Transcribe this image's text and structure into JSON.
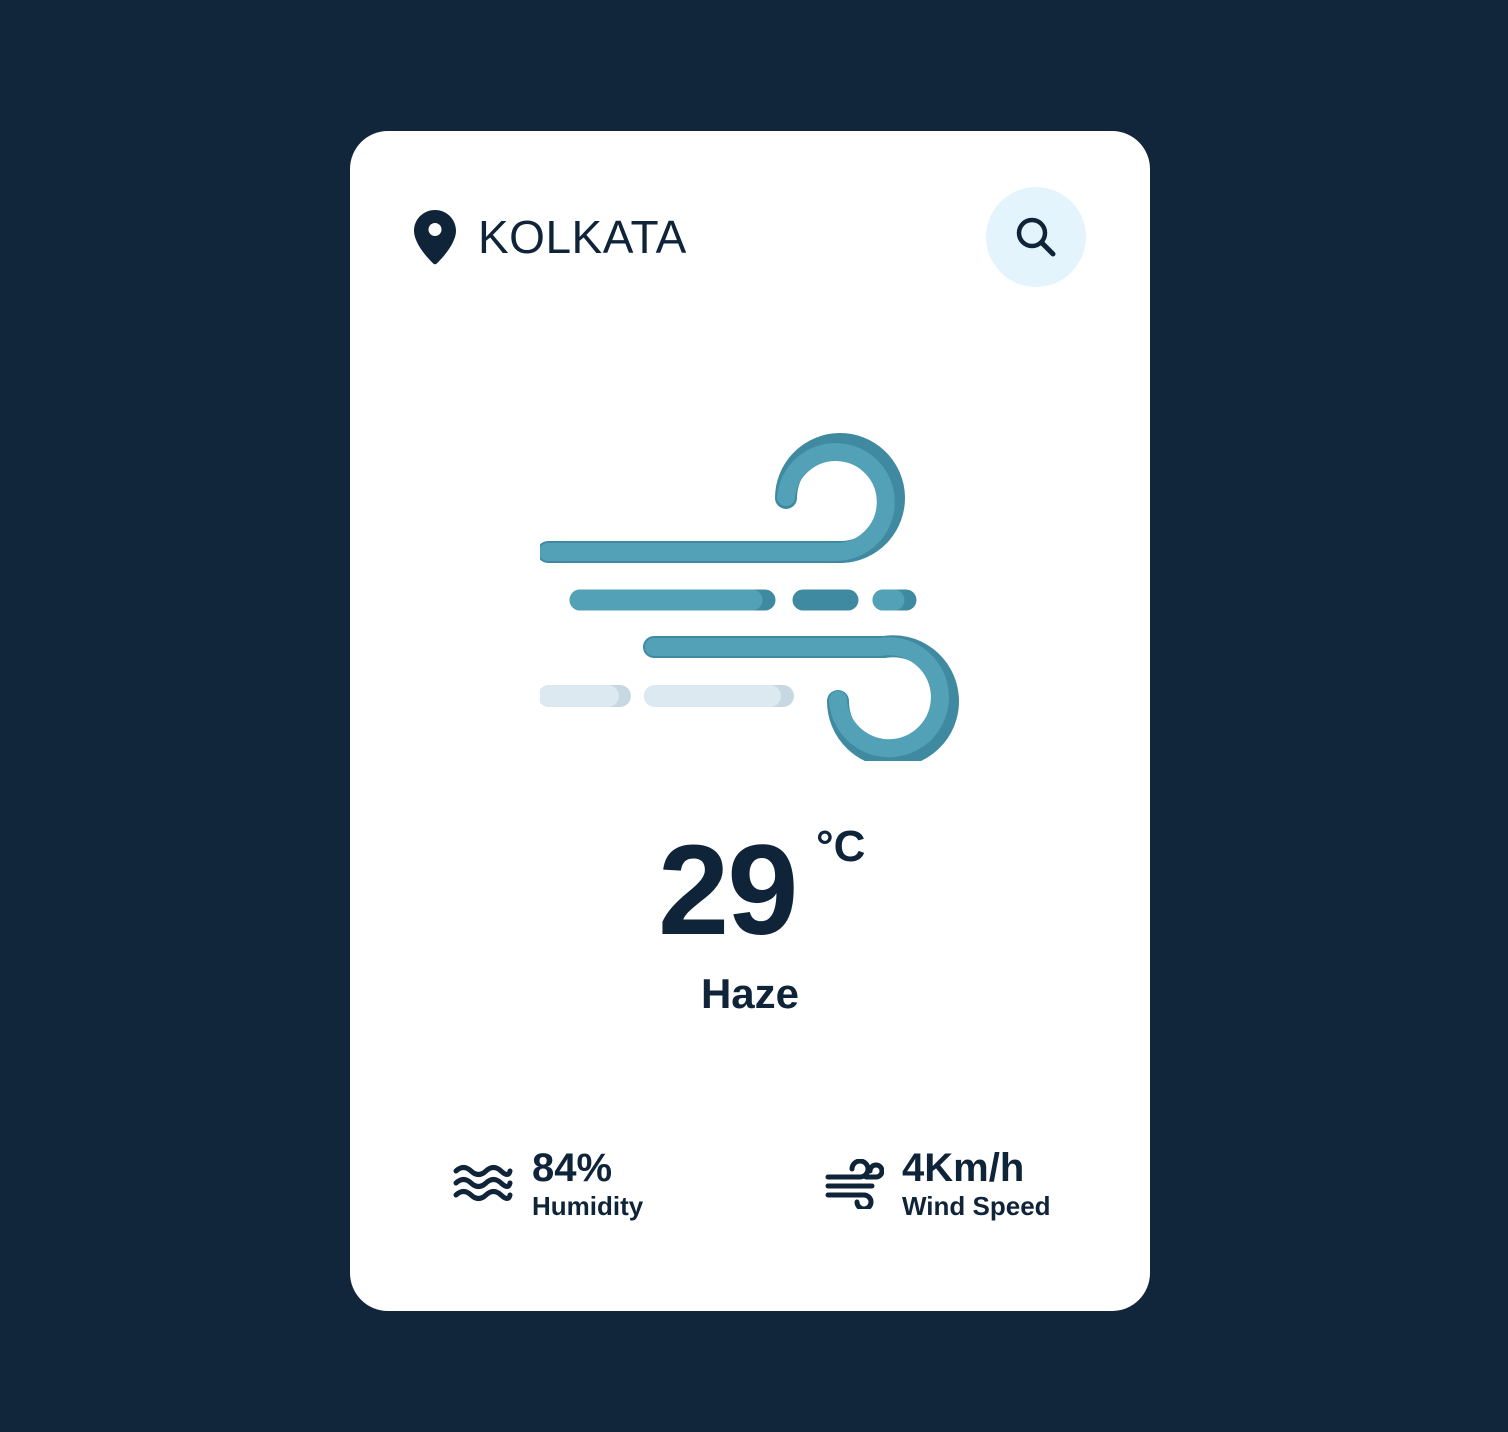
{
  "location": {
    "city": "KOLKATA",
    "icon": "location-pin-icon"
  },
  "search": {
    "icon": "search-icon",
    "button_bg": "#e4f4fd"
  },
  "weather": {
    "icon": "wind-haze-illustration",
    "temperature": "29",
    "unit": "°C",
    "condition": "Haze"
  },
  "stats": {
    "humidity": {
      "value": "84%",
      "label": "Humidity",
      "icon": "waves-icon"
    },
    "wind": {
      "value": "4Km/h",
      "label": "Wind Speed",
      "icon": "wind-icon"
    }
  },
  "colors": {
    "background": "#12263b",
    "card": "#ffffff",
    "text": "#0f2438",
    "accent": "#52a1b6",
    "accent_dark": "#3f8aa1",
    "light_streak": "#dde9f0"
  }
}
